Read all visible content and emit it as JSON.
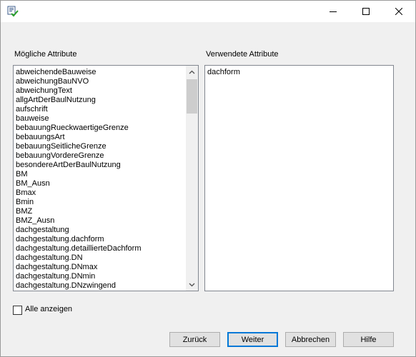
{
  "window": {
    "icon": "form-check-icon",
    "controls": {
      "minimize": "minimize-icon",
      "maximize": "maximize-icon",
      "close": "close-icon"
    }
  },
  "possible": {
    "label": "Mögliche Attribute",
    "items": [
      "abweichendeBauweise",
      "abweichungBauNVO",
      "abweichungText",
      "allgArtDerBaulNutzung",
      "aufschrift",
      "bauweise",
      "bebauungRueckwaertigeGrenze",
      "bebauungsArt",
      "bebauungSeitlicheGrenze",
      "bebauungVordereGrenze",
      "besondereArtDerBaulNutzung",
      "BM",
      "BM_Ausn",
      "Bmax",
      "Bmin",
      "BMZ",
      "BMZ_Ausn",
      "dachgestaltung",
      "dachgestaltung.dachform",
      "dachgestaltung.detaillierteDachform",
      "dachgestaltung.DN",
      "dachgestaltung.DNmax",
      "dachgestaltung.DNmin",
      "dachgestaltung.DNzwingend"
    ]
  },
  "used": {
    "label": "Verwendete Attribute",
    "items": [
      "dachform"
    ]
  },
  "show_all": {
    "label": "Alle anzeigen",
    "checked": false
  },
  "buttons": {
    "back": "Zurück",
    "next": "Weiter",
    "cancel": "Abbrechen",
    "help": "Hilfe"
  }
}
